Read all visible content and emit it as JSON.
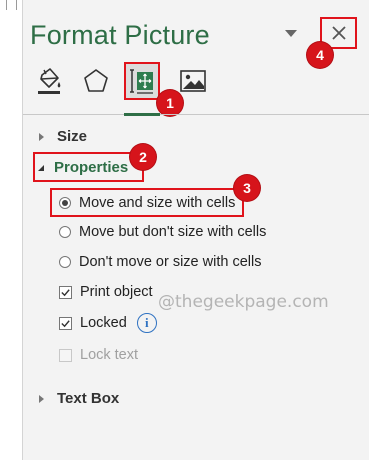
{
  "pane": {
    "title": "Format Picture",
    "close_icon": "close-icon",
    "dropdown_icon": "chevron-down-icon"
  },
  "tabs": [
    {
      "name": "fill-line-icon",
      "selected": false
    },
    {
      "name": "effects-icon",
      "selected": false
    },
    {
      "name": "size-properties-icon",
      "selected": true
    },
    {
      "name": "picture-icon",
      "selected": false
    }
  ],
  "sections": {
    "size": "Size",
    "properties": "Properties",
    "text_box": "Text Box"
  },
  "options": {
    "move_size": "Move and size with cells",
    "move_no_size": "Move but don't size with cells",
    "dont_move": "Don't move or size with cells",
    "print_object": "Print object",
    "locked": "Locked",
    "lock_text": "Lock text"
  },
  "info_icon": "i",
  "watermark": "@thegeekpage.com",
  "badges": [
    "1",
    "2",
    "3",
    "4"
  ],
  "colors": {
    "accent_green": "#2e6e46",
    "annotation_red": "#e0131b",
    "info_blue": "#2f72c2"
  }
}
